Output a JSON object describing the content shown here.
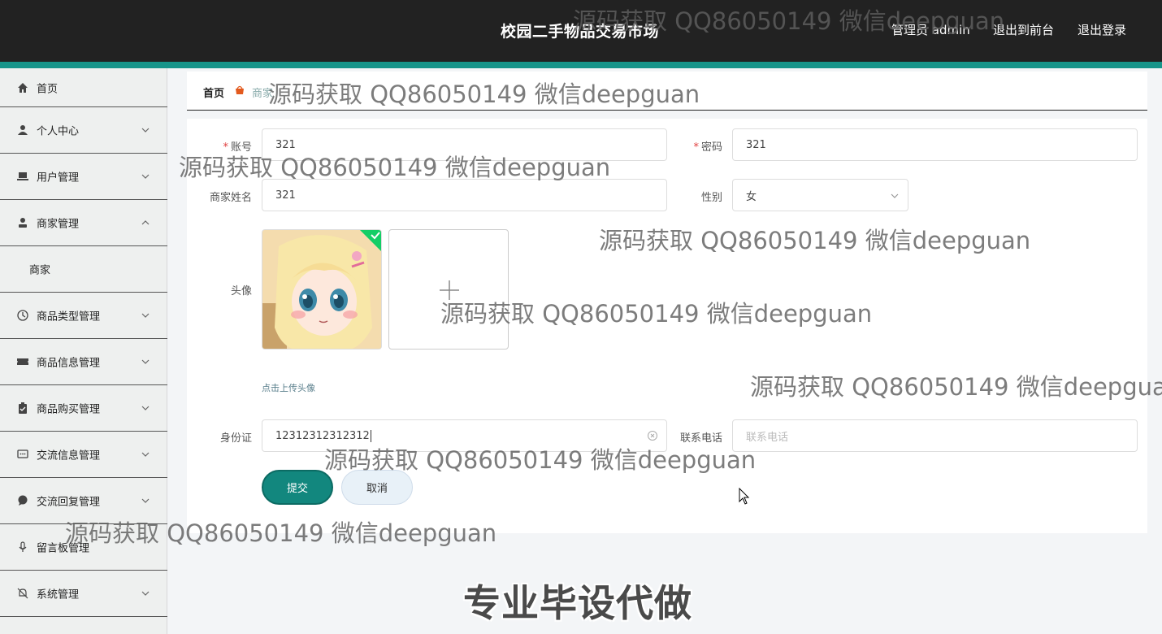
{
  "header": {
    "app_title": "校园二手物品交易市场",
    "admin_label": "管理员 admin",
    "front_label": "退出到前台",
    "logout_label": "退出登录"
  },
  "sidebar": {
    "items": [
      {
        "label": "首页",
        "icon": "home-icon"
      },
      {
        "label": "个人中心",
        "icon": "user-icon"
      },
      {
        "label": "用户管理",
        "icon": "laptop-icon"
      },
      {
        "label": "商家管理",
        "icon": "person-icon"
      },
      {
        "label": "商家",
        "icon": ""
      },
      {
        "label": "商品类型管理",
        "icon": "clock-icon"
      },
      {
        "label": "商品信息管理",
        "icon": "ticket-icon"
      },
      {
        "label": "商品购买管理",
        "icon": "clipboard-icon"
      },
      {
        "label": "交流信息管理",
        "icon": "chat-icon"
      },
      {
        "label": "交流回复管理",
        "icon": "bubble-icon"
      },
      {
        "label": "留言板管理",
        "icon": "mic-icon"
      },
      {
        "label": "系统管理",
        "icon": "bell-off-icon"
      }
    ]
  },
  "breadcrumb": {
    "home": "首页",
    "current": "商家"
  },
  "form": {
    "account": {
      "label": "账号",
      "value": "321"
    },
    "password": {
      "label": "密码",
      "value": "321"
    },
    "merchant_name": {
      "label": "商家姓名",
      "value": "321"
    },
    "gender": {
      "label": "性别",
      "value": "女"
    },
    "avatar": {
      "label": "头像",
      "hint": "点击上传头像"
    },
    "id_card": {
      "label": "身份证",
      "value": "12312312312312"
    },
    "phone": {
      "label": "联系电话",
      "placeholder": "联系电话"
    },
    "submit_label": "提交",
    "cancel_label": "取消"
  },
  "overlay": {
    "watermark_text": "源码获取 QQ86050149 微信deepguan",
    "promo_text": "专业毕设代做"
  },
  "colors": {
    "topbar": "#222222",
    "accent": "#17958a",
    "submit": "#12877e"
  }
}
